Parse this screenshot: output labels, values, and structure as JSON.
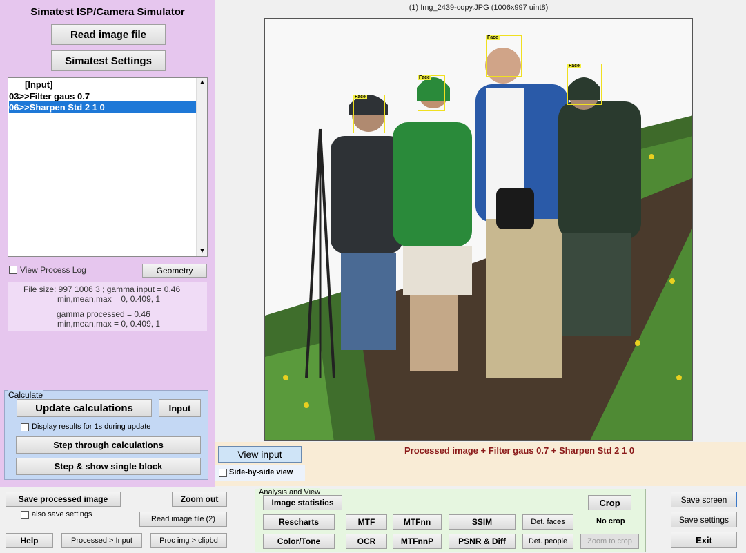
{
  "app": {
    "title": "Simatest ISP/Camera Simulator",
    "read_image_btn": "Read image file",
    "settings_btn": "Simatest Settings"
  },
  "process_list": {
    "items": [
      "[Input]",
      "03>>Filter gaus 0.7",
      "06>>Sharpen Std 2 1 0"
    ],
    "selected_index": 2
  },
  "log": {
    "view_process_log": "View Process Log",
    "geometry_btn": "Geometry"
  },
  "info": {
    "line1": "File size: 997  1006     3 ;   gamma input = 0.46",
    "line2": "min,mean,max = 0, 0.409, 1",
    "line3": "gamma processed = 0.46",
    "line4": "min,mean,max = 0, 0.409, 1"
  },
  "calculate": {
    "group_label": "Calculate",
    "update_btn": "Update calculations",
    "input_btn": "Input",
    "display_results": "Display results for 1s during update",
    "step_through_btn": "Step through calculations",
    "step_show_btn": "Step & show single block"
  },
  "image": {
    "title": "(1) Img_2439-copy.JPG  (1006x997  uint8)",
    "face_label": "Face",
    "caption": "Processed image  + Filter gaus 0.7 + Sharpen Std 2 1 0"
  },
  "view": {
    "view_input_btn": "View input",
    "side_by_side": "Side-by-side view"
  },
  "bottom_left": {
    "save_processed_btn": "Save processed image",
    "zoom_out_btn": "Zoom out",
    "also_save_settings": "also save settings",
    "read_image2_btn": "Read image file (2)",
    "help_btn": "Help",
    "processed_input_btn": "Processed > Input",
    "proc_clipbd_btn": "Proc img > clipbd"
  },
  "analysis": {
    "group_label": "Analysis and View",
    "image_stats_btn": "Image statistics",
    "crop_btn": "Crop",
    "rescharts_btn": "Rescharts",
    "mtf_btn": "MTF",
    "mtfnn_btn": "MTFnn",
    "ssim_btn": "SSIM",
    "det_faces_btn": "Det. faces",
    "no_crop": "No crop",
    "color_tone_btn": "Color/Tone",
    "ocr_btn": "OCR",
    "mtfnnp_btn": "MTFnnP",
    "psnr_btn": "PSNR & Diff",
    "det_people_btn": "Det. people",
    "zoom_to_crop_btn": "Zoom to crop"
  },
  "right_buttons": {
    "save_screen_btn": "Save screen",
    "save_settings_btn": "Save settings",
    "exit_btn": "Exit"
  },
  "colors": {
    "left_panel": "#e6c6ee",
    "calc_group": "#c4d8f4",
    "analysis_group": "#e6f6e0",
    "caption_strip": "#f9ecd6",
    "caption_text": "#8b1a1a",
    "selection": "#1e78d7"
  }
}
